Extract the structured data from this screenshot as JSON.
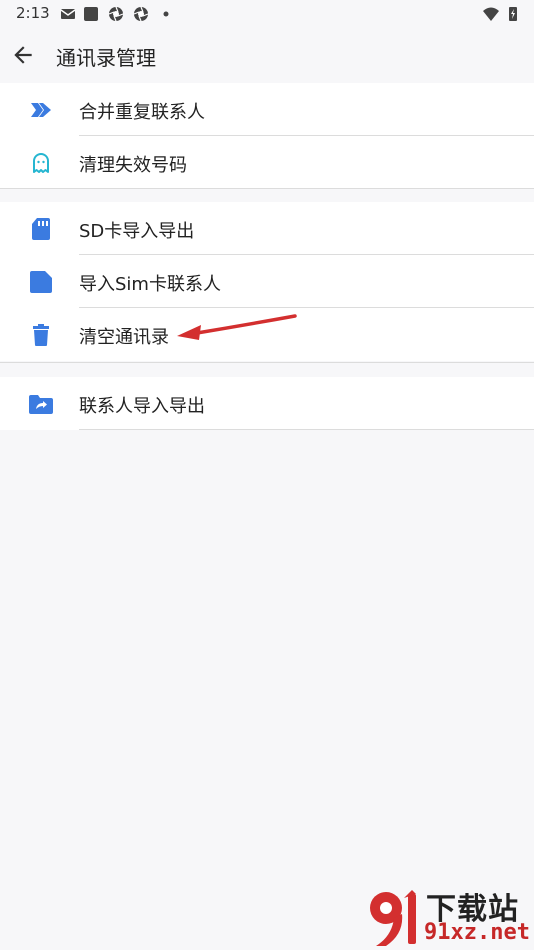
{
  "status_bar": {
    "time": "2:13",
    "icons": [
      "mail-icon",
      "square-icon",
      "aperture-icon",
      "aperture-icon",
      "dot-icon",
      "wifi-icon",
      "battery-icon"
    ]
  },
  "header": {
    "back_icon": "arrow-left-icon",
    "title": "通讯录管理"
  },
  "sections": [
    {
      "items": [
        {
          "icon": "merge-icon",
          "label": "合并重复联系人"
        },
        {
          "icon": "ghost-icon",
          "label": "清理失效号码"
        }
      ]
    },
    {
      "items": [
        {
          "icon": "sd-card-icon",
          "label": "SD卡导入导出"
        },
        {
          "icon": "sim-card-icon",
          "label": "导入Sim卡联系人"
        },
        {
          "icon": "trash-icon",
          "label": "清空通讯录"
        }
      ]
    },
    {
      "items": [
        {
          "icon": "folder-share-icon",
          "label": "联系人导入导出"
        }
      ]
    }
  ],
  "annotation": {
    "color": "#d32f2f"
  },
  "watermark": {
    "brand": "下载站",
    "url": "91xz.net"
  },
  "colors": {
    "accent": "#3b7be0",
    "ghost": "#26b6d1",
    "background": "#f7f7f9",
    "annotation": "#d32f2f"
  }
}
